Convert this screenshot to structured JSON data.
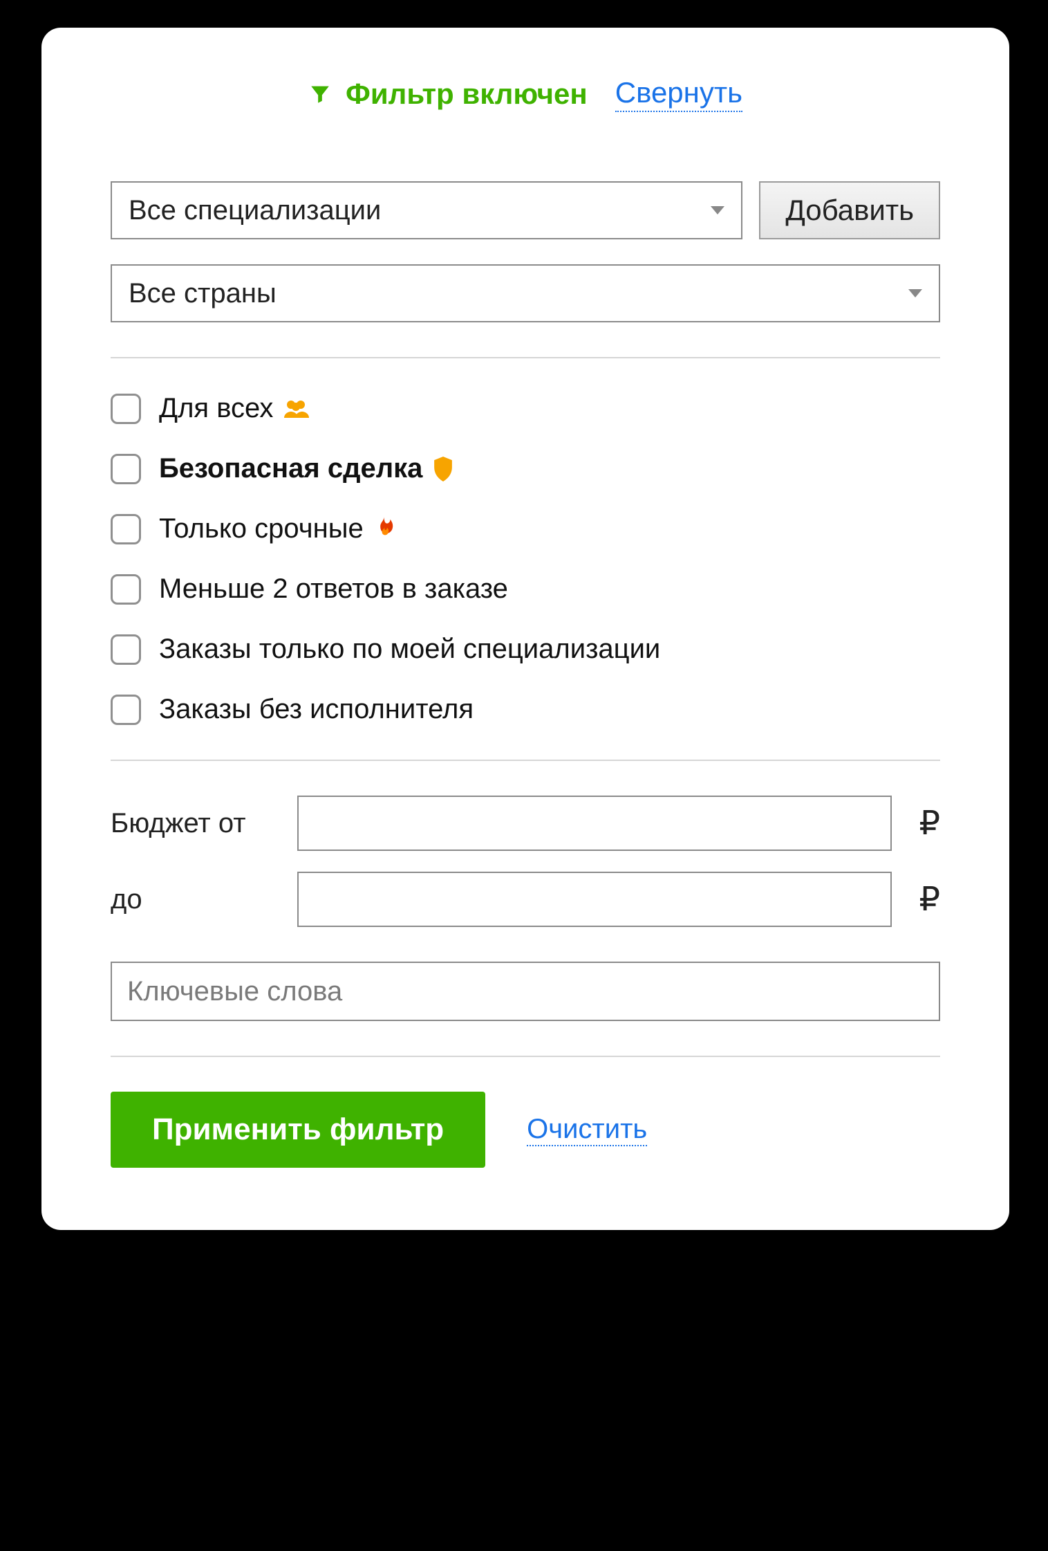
{
  "header": {
    "title": "Фильтр включен",
    "collapse": "Свернуть"
  },
  "specialization": {
    "selected": "Все специализации",
    "add_label": "Добавить"
  },
  "country": {
    "selected": "Все страны"
  },
  "checkboxes": [
    {
      "label": "Для всех",
      "icon": "people-icon",
      "bold": false
    },
    {
      "label": "Безопасная сделка",
      "icon": "shield-icon",
      "bold": true
    },
    {
      "label": "Только срочные",
      "icon": "fire-icon",
      "bold": false
    },
    {
      "label": "Меньше 2 ответов в заказе",
      "icon": null,
      "bold": false
    },
    {
      "label": "Заказы только по моей специализации",
      "icon": null,
      "bold": false
    },
    {
      "label": "Заказы без исполнителя",
      "icon": null,
      "bold": false
    }
  ],
  "budget": {
    "from_label": "Бюджет от",
    "to_label": "до",
    "currency": "₽"
  },
  "keywords": {
    "placeholder": "Ключевые слова"
  },
  "actions": {
    "apply": "Применить фильтр",
    "clear": "Очистить"
  }
}
